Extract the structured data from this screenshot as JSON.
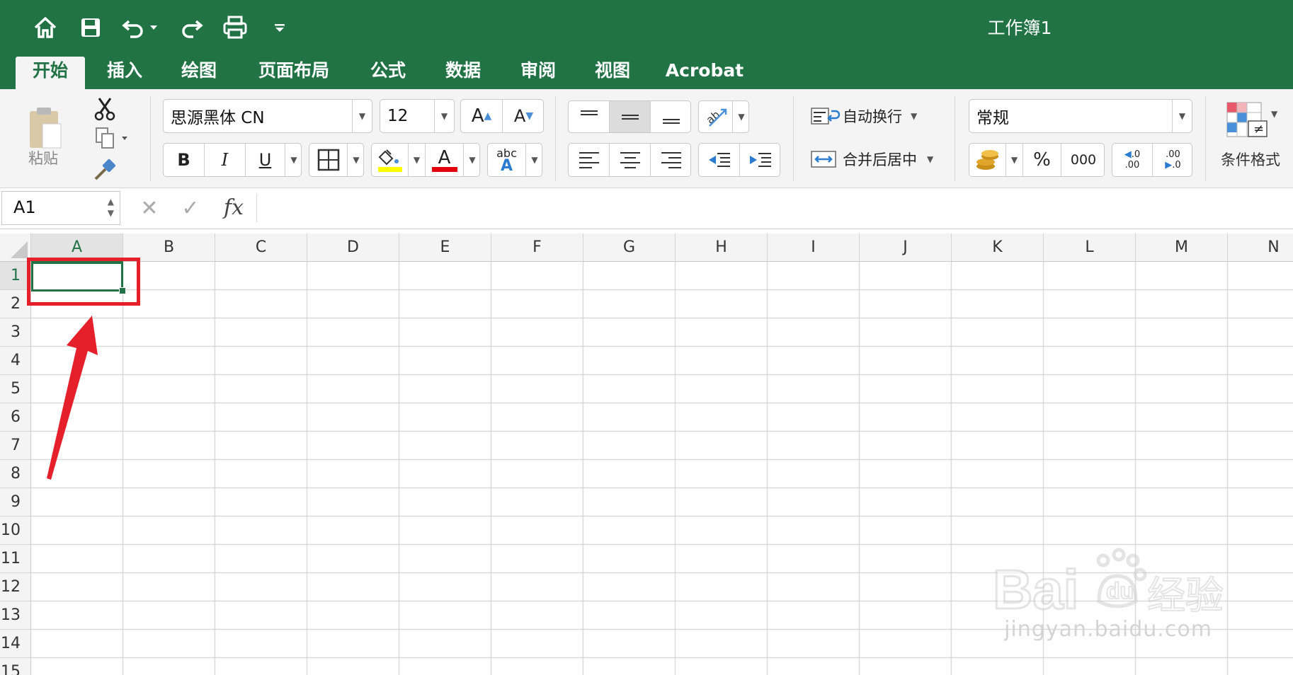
{
  "window": {
    "title": "工作簿1"
  },
  "quick_access": [
    {
      "name": "home-icon"
    },
    {
      "name": "save-icon"
    },
    {
      "name": "undo-icon"
    },
    {
      "name": "redo-icon"
    },
    {
      "name": "print-icon"
    },
    {
      "name": "customize-toolbar-icon"
    }
  ],
  "tabs": [
    "开始",
    "插入",
    "绘图",
    "页面布局",
    "公式",
    "数据",
    "审阅",
    "视图",
    "Acrobat"
  ],
  "active_tab": "开始",
  "ribbon": {
    "clipboard": {
      "paste_label": "粘贴"
    },
    "font": {
      "family": "思源黑体 CN",
      "size": "12",
      "grow_label": "A",
      "shrink_label": "A",
      "bold": "B",
      "italic": "I",
      "underline": "U",
      "font_color_glyph": "A",
      "phonetic_top": "abc",
      "phonetic_bottom": "A",
      "fill_color": "#ffff00",
      "font_color": "#e5000f"
    },
    "alignment": {
      "wrap_text": "自动换行",
      "merge_center": "合并后居中"
    },
    "number": {
      "format": "常规",
      "percent": "%",
      "comma": "000",
      "inc_decimal_top": ".0",
      "inc_decimal_bottom": ".00",
      "dec_decimal_top": ".00",
      "dec_decimal_bottom": ".0"
    },
    "styles": {
      "conditional_format": "条件格式"
    }
  },
  "formula_bar": {
    "name_box": "A1",
    "cancel_glyph": "✕",
    "enter_glyph": "✓",
    "fx_label": "fx",
    "content": ""
  },
  "sheet": {
    "columns": [
      "A",
      "B",
      "C",
      "D",
      "E",
      "F",
      "G",
      "H",
      "I",
      "J",
      "K",
      "L",
      "M",
      "N"
    ],
    "rows": [
      "1",
      "2",
      "3",
      "4",
      "5",
      "6",
      "7",
      "8",
      "9",
      "10",
      "11",
      "12",
      "13",
      "14",
      "15"
    ],
    "selected_cell": "A1",
    "accent": "#217346",
    "annotation_color": "#e5202a"
  },
  "watermark": {
    "url": "jingyan.baidu.com"
  }
}
